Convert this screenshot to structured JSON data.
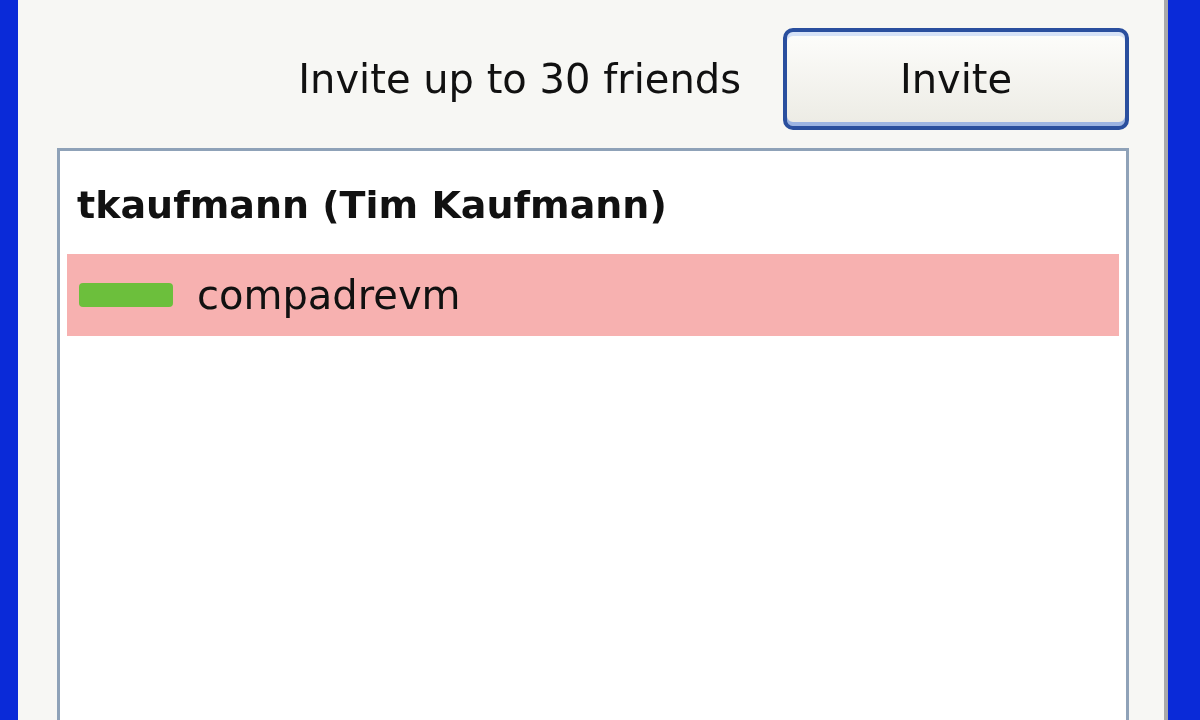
{
  "invite_bar": {
    "label": "Invite up to 30 friends",
    "button": "Invite"
  },
  "contact_list": {
    "owner": "tkaufmann (Tim Kaufmann)",
    "contacts": [
      {
        "name": "compadrevm",
        "selected": true,
        "color": "#6cbf3c"
      }
    ]
  }
}
